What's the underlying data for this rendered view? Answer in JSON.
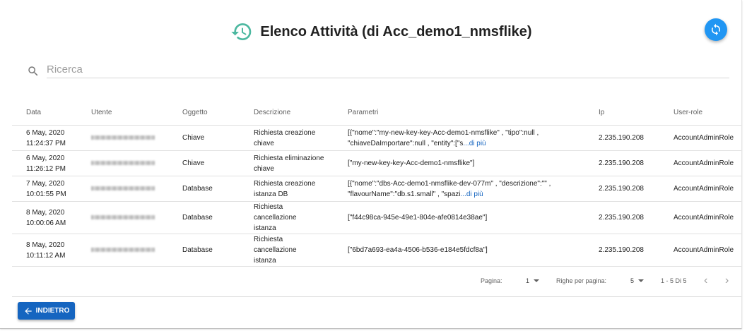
{
  "header": {
    "title": "Elenco Attività (di Acc_demo1_nmsflike)",
    "icon": "history-icon",
    "refresh_icon": "refresh-icon"
  },
  "search": {
    "placeholder": "Ricerca",
    "value": ""
  },
  "table": {
    "columns": [
      "Data",
      "Utente",
      "Oggetto",
      "Descrizione",
      "Parametri",
      "Ip",
      "User-role"
    ],
    "rows": [
      {
        "date": "6 May, 2020",
        "time": "11:24:37 PM",
        "utente": "",
        "oggetto": "Chiave",
        "descrizione": "Richiesta creazione chiave",
        "parametri": "[{\"nome\":\"my-new-key-key-Acc-demo1-nmsflike\" , \"tipo\":null , \"chiaveDaImportare\":null , \"entity\":[\"s",
        "more": "...di più",
        "ip": "2.235.190.208",
        "role": "AccountAdminRole"
      },
      {
        "date": "6 May, 2020",
        "time": "11:26:12 PM",
        "utente": "",
        "oggetto": "Chiave",
        "descrizione": "Richiesta eliminazione chiave",
        "parametri": "[\"my-new-key-key-Acc-demo1-nmsflike\"]",
        "more": "",
        "ip": "2.235.190.208",
        "role": "AccountAdminRole"
      },
      {
        "date": "7 May, 2020",
        "time": "10:01:55 PM",
        "utente": "",
        "oggetto": "Database",
        "descrizione": "Richiesta creazione istanza DB",
        "parametri": "[{\"nome\":\"dbs-Acc-demo1-nmsflike-dev-077m\" , \"descrizione\":\"\" , \"flavourName\":\"db.s1.small\" , \"spazi",
        "more": "...di più",
        "ip": "2.235.190.208",
        "role": "AccountAdminRole"
      },
      {
        "date": "8 May, 2020",
        "time": "10:00:06 AM",
        "utente": "",
        "oggetto": "Database",
        "descrizione": "Richiesta cancellazione istanza",
        "parametri": "[\"f44c98ca-945e-49e1-804e-afe0814e38ae\"]",
        "more": "",
        "ip": "2.235.190.208",
        "role": "AccountAdminRole"
      },
      {
        "date": "8 May, 2020",
        "time": "10:11:12 AM",
        "utente": "",
        "oggetto": "Database",
        "descrizione": "Richiesta cancellazione istanza",
        "parametri": "[\"6bd7a693-ea4a-4506-b536-e184e5fdcf8a\"]",
        "more": "",
        "ip": "2.235.190.208",
        "role": "AccountAdminRole"
      }
    ]
  },
  "pagination": {
    "page_label": "Pagina:",
    "page_value": "1",
    "per_page_label": "Righe per pagina:",
    "per_page_value": "5",
    "range": "1 - 5 Di 5",
    "prev_icon": "chevron-left-icon",
    "next_icon": "chevron-right-icon"
  },
  "back_button": {
    "label": "INDIETRO",
    "icon": "arrow-left-icon"
  },
  "colors": {
    "accent": "#2196f3",
    "primary_button": "#1565c0",
    "history_icon": "#4cb8a0",
    "link": "#1565c0"
  }
}
